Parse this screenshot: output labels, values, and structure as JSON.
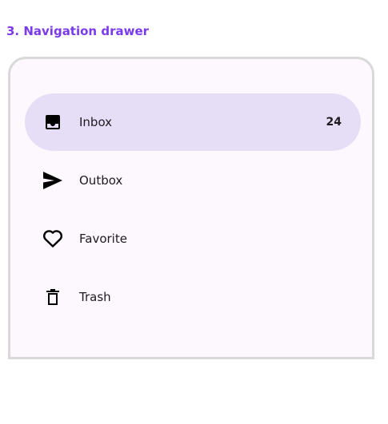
{
  "section": {
    "title": "3. Navigation drawer"
  },
  "drawer": {
    "items": [
      {
        "label": "Inbox",
        "icon": "inbox-icon",
        "badge": "24",
        "active": true
      },
      {
        "label": "Outbox",
        "icon": "send-icon",
        "badge": "",
        "active": false
      },
      {
        "label": "Favorite",
        "icon": "heart-icon",
        "badge": "",
        "active": false
      },
      {
        "label": "Trash",
        "icon": "trash-icon",
        "badge": "",
        "active": false
      }
    ]
  },
  "colors": {
    "accent": "#7c3aed",
    "active_background": "#e6def6",
    "drawer_background": "#fdf8fd",
    "border": "#d9d9d9"
  }
}
